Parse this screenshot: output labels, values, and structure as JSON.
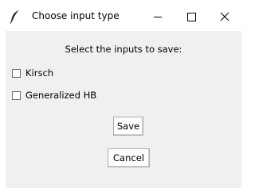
{
  "window": {
    "title": "Choose input type",
    "controls": {
      "minimize_glyph": "—",
      "maximize_glyph": "☐",
      "close_glyph": "✕"
    },
    "icon": "feather-icon"
  },
  "dialog": {
    "prompt": "Select the inputs to save:",
    "options": [
      {
        "label": "Kirsch",
        "checked": false
      },
      {
        "label": "Generalized HB",
        "checked": false
      }
    ],
    "buttons": {
      "save_label": "Save",
      "cancel_label": "Cancel"
    }
  },
  "colors": {
    "window_background": "#f0f0f0",
    "titlebar_background": "#ffffff",
    "button_background": "#fdfdfd",
    "button_border": "#adadad"
  }
}
